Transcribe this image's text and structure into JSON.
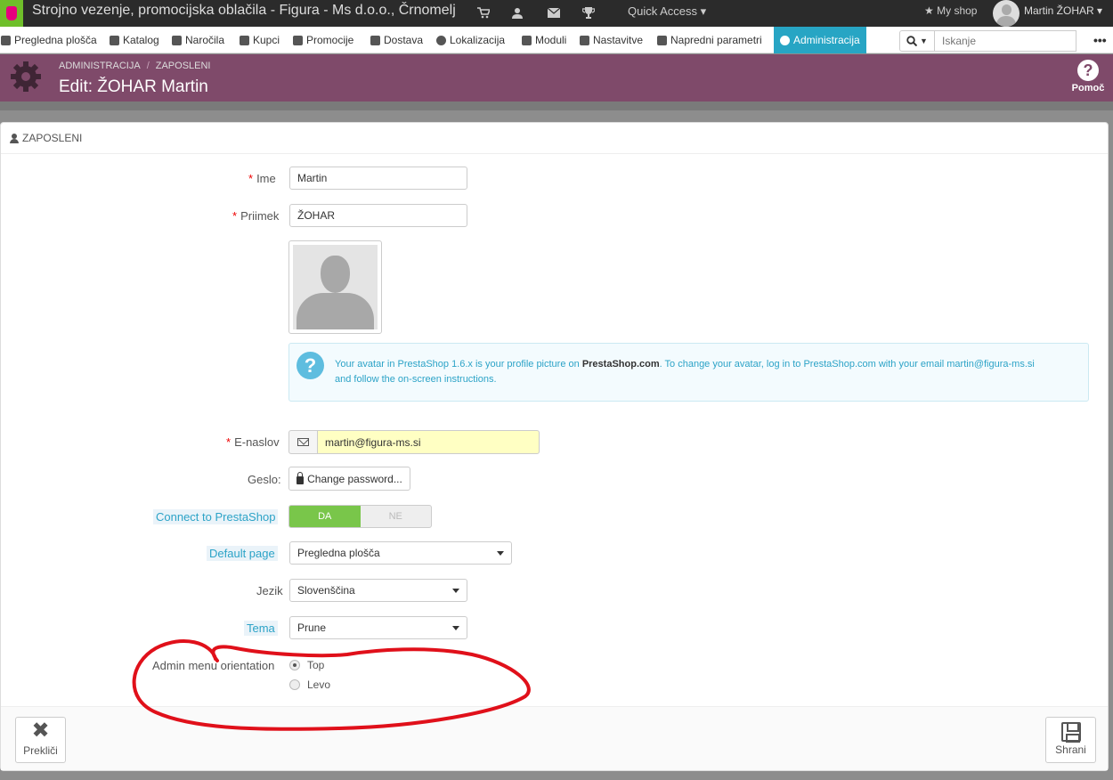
{
  "topbar": {
    "shop_title": "Strojno vezenje, promocijska oblačila - Figura - Ms d.o.o., Črnomelj",
    "quick_access": "Quick Access",
    "my_shop": "My shop",
    "username": "Martin ŽOHAR"
  },
  "nav": {
    "items": [
      {
        "label": "Pregledna plošča",
        "icon": "dashboard-icon"
      },
      {
        "label": "Katalog",
        "icon": "book-icon"
      },
      {
        "label": "Naročila",
        "icon": "credit-card-icon"
      },
      {
        "label": "Kupci",
        "icon": "users-icon"
      },
      {
        "label": "Promocije",
        "icon": "tag-icon"
      },
      {
        "label": "Dostava",
        "icon": "truck-icon"
      },
      {
        "label": "Lokalizacija",
        "icon": "globe-icon"
      },
      {
        "label": "Moduli",
        "icon": "puzzle-icon"
      },
      {
        "label": "Nastavitve",
        "icon": "wrench-icon"
      },
      {
        "label": "Napredni parametri",
        "icon": "cogs-icon"
      },
      {
        "label": "Administracija",
        "icon": "gear-icon"
      }
    ],
    "active": "Administracija",
    "search_placeholder": "Iskanje"
  },
  "header": {
    "breadcrumb": [
      "ADMINISTRACIJA",
      "ZAPOSLENI"
    ],
    "title": "Edit: ŽOHAR Martin",
    "help_label": "Pomoč"
  },
  "panel": {
    "heading": "ZAPOSLENI"
  },
  "form": {
    "first_name": {
      "label": "Ime",
      "value": "Martin"
    },
    "last_name": {
      "label": "Priimek",
      "value": "ŽOHAR"
    },
    "avatar_info": {
      "text_before": "Your avatar in PrestaShop 1.6.x is your profile picture on ",
      "text_bold": "PrestaShop.com",
      "text_after": ". To change your avatar, log in to PrestaShop.com with your email martin@figura-ms.si and follow the on-screen instructions."
    },
    "email": {
      "label": "E-naslov",
      "value": "martin@figura-ms.si"
    },
    "password": {
      "label": "Geslo:",
      "button": "Change password..."
    },
    "connect": {
      "label": "Connect to PrestaShop",
      "on": "DA",
      "off": "NE",
      "value": "DA"
    },
    "default_page": {
      "label": "Default page",
      "value": "Pregledna plošča"
    },
    "language": {
      "label": "Jezik",
      "value": "Slovenščina"
    },
    "theme": {
      "label": "Tema",
      "value": "Prune"
    },
    "menu_orientation": {
      "label": "Admin menu orientation",
      "options": [
        "Top",
        "Levo"
      ],
      "selected": "Top"
    }
  },
  "footer": {
    "cancel": "Prekliči",
    "save": "Shrani"
  },
  "colors": {
    "header": "#7f4a6a",
    "active_nav": "#27a5c4",
    "switch_on": "#79c64a",
    "annotation": "#e0101a"
  }
}
